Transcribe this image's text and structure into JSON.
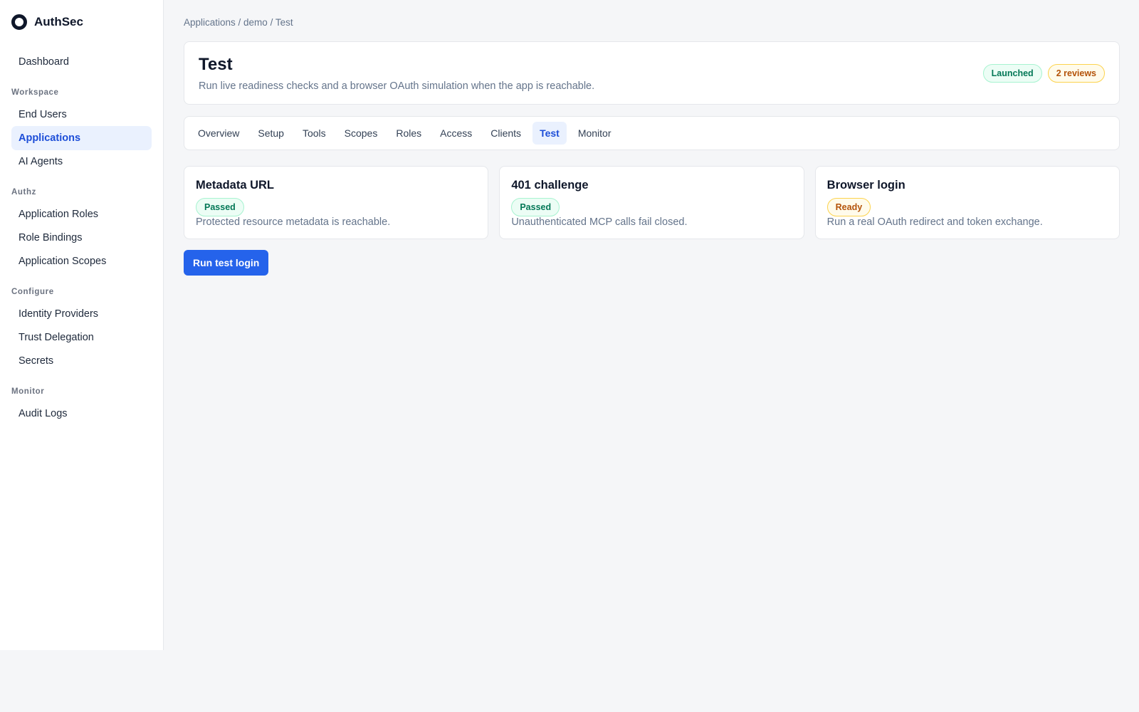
{
  "brand": {
    "name": "AuthSec",
    "logo_icon": "ring-logo-icon"
  },
  "sidebar": {
    "dashboard": "Dashboard",
    "sections": [
      {
        "title": "Workspace",
        "items": [
          "End Users",
          "Applications",
          "AI Agents"
        ]
      },
      {
        "title": "Authz",
        "items": [
          "Application Roles",
          "Role Bindings",
          "Application Scopes"
        ]
      },
      {
        "title": "Configure",
        "items": [
          "Identity Providers",
          "Trust Delegation",
          "Secrets"
        ]
      },
      {
        "title": "Monitor",
        "items": [
          "Audit Logs"
        ]
      }
    ],
    "active_item": "Applications"
  },
  "breadcrumb": "Applications / demo / Test",
  "header": {
    "title": "Test",
    "subtitle": "Run live readiness checks and a browser OAuth simulation when the app is reachable.",
    "badges": [
      {
        "label": "Launched",
        "tone": "green"
      },
      {
        "label": "2 reviews",
        "tone": "amber"
      }
    ]
  },
  "tabs": [
    "Overview",
    "Setup",
    "Tools",
    "Scopes",
    "Roles",
    "Access",
    "Clients",
    "Test",
    "Monitor"
  ],
  "active_tab": "Test",
  "checks": [
    {
      "title": "Metadata URL",
      "status": "Passed",
      "tone": "green",
      "description": "Protected resource metadata is reachable."
    },
    {
      "title": "401 challenge",
      "status": "Passed",
      "tone": "green",
      "description": "Unauthenticated MCP calls fail closed."
    },
    {
      "title": "Browser login",
      "status": "Ready",
      "tone": "amber",
      "description": "Run a real OAuth redirect and token exchange."
    }
  ],
  "actions": {
    "run_test_login": "Run test login"
  },
  "colors": {
    "accent": "#2563eb",
    "active_bg": "#eaf1fe",
    "success": "#047857",
    "warning": "#b45309"
  }
}
